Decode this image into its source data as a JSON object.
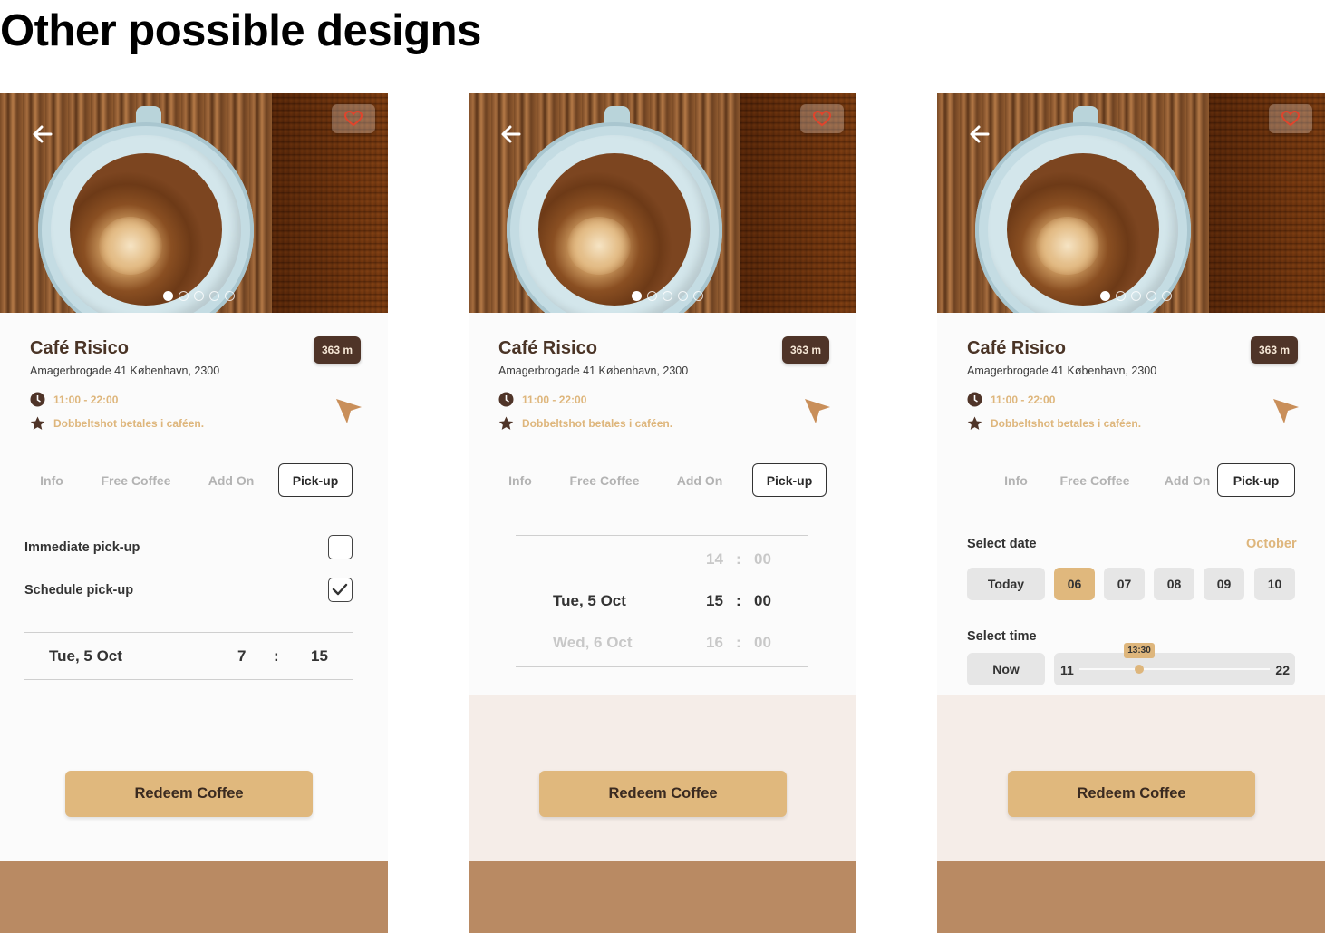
{
  "page": {
    "title": "Other possible designs"
  },
  "colors": {
    "accent": "#e0b87d",
    "dark_brown": "#4f3428",
    "footer_brown": "#b98a63",
    "muted_text": "#deb67c"
  },
  "cafe": {
    "name": "Café Risico",
    "address": "Amagerbrogade 41 København, 2300",
    "distance": "363 m",
    "hours": "11:00 - 22:00",
    "note": "Dobbeltshot betales i caféen."
  },
  "tabs": [
    "Info",
    "Free Coffee",
    "Add On",
    "Pick-up"
  ],
  "active_tab": "Pick-up",
  "redeem_label": "Redeem Coffee",
  "design1": {
    "immediate_label": "Immediate pick-up",
    "immediate_checked": false,
    "schedule_label": "Schedule pick-up",
    "schedule_checked": true,
    "date": "Tue, 5 Oct",
    "hour": "7",
    "separator": ":",
    "minute": "15"
  },
  "design2": {
    "rows": [
      {
        "date": "",
        "hour": "14",
        "sep": ":",
        "minute": "00"
      },
      {
        "date": "Tue, 5 Oct",
        "hour": "15",
        "sep": ":",
        "minute": "00"
      },
      {
        "date": "Wed, 6 Oct",
        "hour": "16",
        "sep": ":",
        "minute": "00"
      }
    ]
  },
  "design3": {
    "select_date_label": "Select date",
    "month": "October",
    "dates": [
      "Today",
      "06",
      "07",
      "08",
      "09",
      "10"
    ],
    "selected_date": "06",
    "select_time_label": "Select time",
    "now_label": "Now",
    "time_min": "11",
    "time_max": "22",
    "time_value": "13:30"
  }
}
